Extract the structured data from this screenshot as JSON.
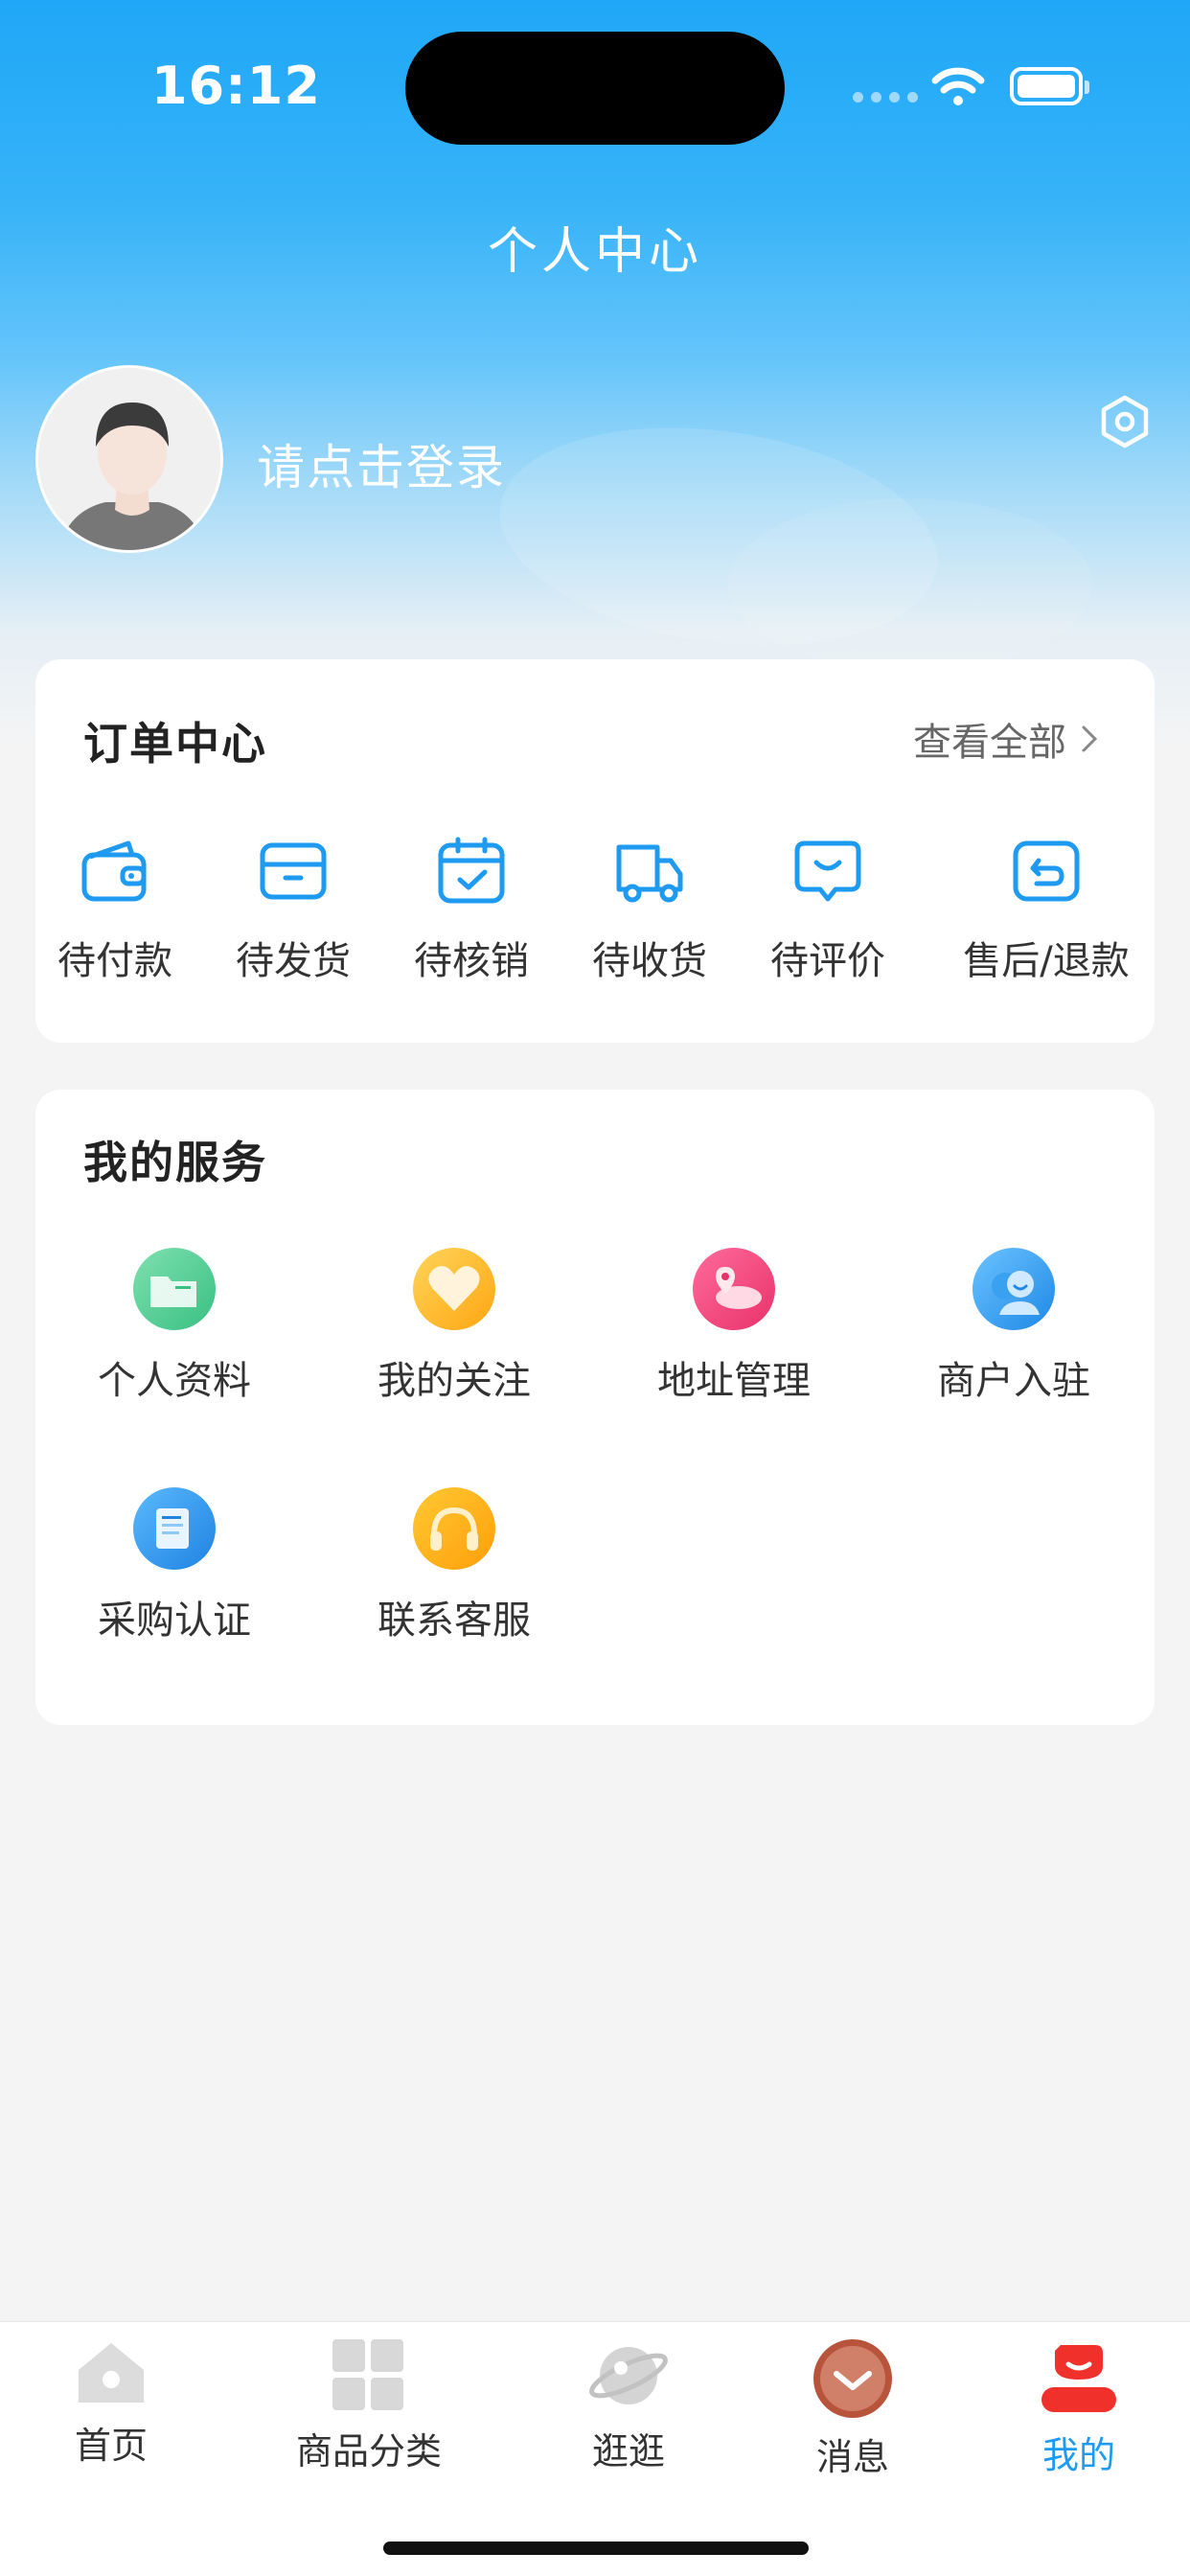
{
  "status_bar": {
    "time": "16:12"
  },
  "header": {
    "title": "个人中心"
  },
  "profile": {
    "login_prompt": "请点击登录"
  },
  "orders": {
    "title": "订单中心",
    "view_all": "查看全部",
    "items": [
      {
        "label": "待付款",
        "icon": "wallet-icon"
      },
      {
        "label": "待发货",
        "icon": "box-icon"
      },
      {
        "label": "待核销",
        "icon": "calendar-check-icon"
      },
      {
        "label": "待收货",
        "icon": "truck-icon"
      },
      {
        "label": "待评价",
        "icon": "comment-icon"
      },
      {
        "label": "售后/退款",
        "icon": "return-icon"
      }
    ]
  },
  "services": {
    "title": "我的服务",
    "items": [
      {
        "label": "个人资料",
        "icon": "folder-icon",
        "color": "#4cc98f"
      },
      {
        "label": "我的关注",
        "icon": "heart-icon",
        "color": "#ffb31f"
      },
      {
        "label": "地址管理",
        "icon": "map-pin-icon",
        "color": "#f5457a"
      },
      {
        "label": "商户入驻",
        "icon": "merchant-icon",
        "color": "#2f9af2"
      },
      {
        "label": "采购认证",
        "icon": "document-icon",
        "color": "#2f9af2"
      },
      {
        "label": "联系客服",
        "icon": "headset-icon",
        "color": "#ffae0f"
      }
    ]
  },
  "tabbar": {
    "items": [
      {
        "label": "首页",
        "icon": "home-icon",
        "active": false
      },
      {
        "label": "商品分类",
        "icon": "category-grid-icon",
        "active": false
      },
      {
        "label": "逛逛",
        "icon": "planet-icon",
        "active": false
      },
      {
        "label": "消息",
        "icon": "message-icon",
        "active": false
      },
      {
        "label": "我的",
        "icon": "profile-icon",
        "active": true
      }
    ],
    "active_color": "#1e9bf0"
  },
  "colors": {
    "brand_blue": "#1fa7f7",
    "icon_blue": "#1e9bf0"
  }
}
